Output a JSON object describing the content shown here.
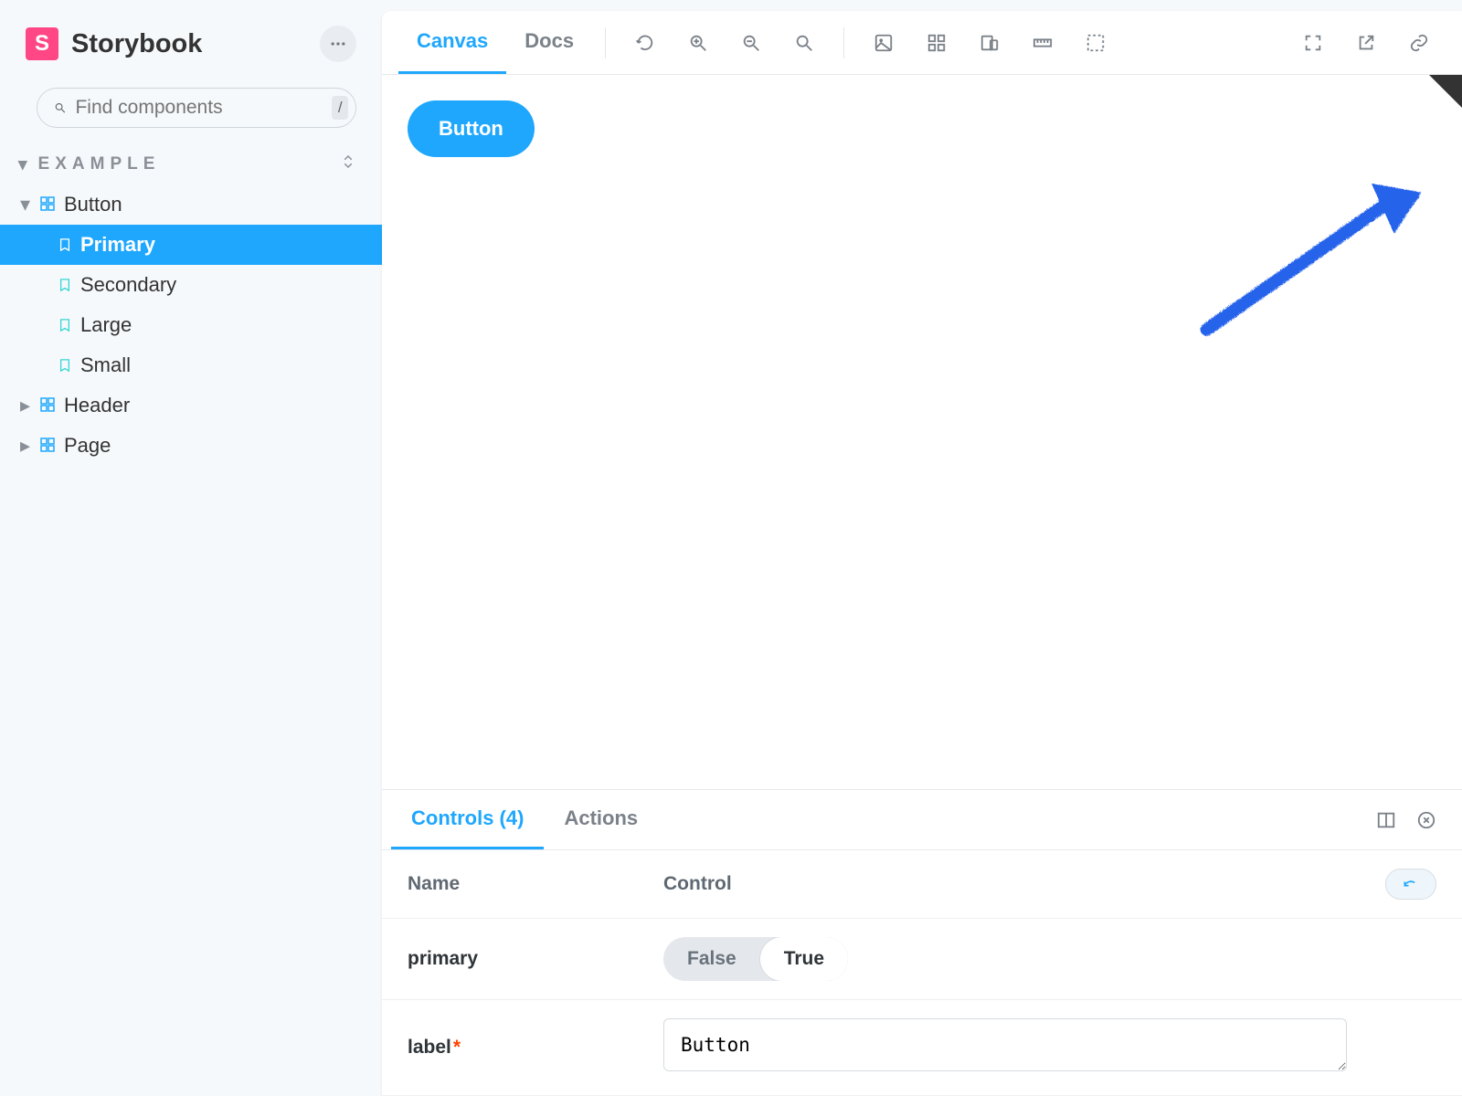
{
  "brand": {
    "name": "Storybook",
    "logo_letter": "S"
  },
  "search": {
    "placeholder": "Find components",
    "shortcut": "/"
  },
  "sidebar": {
    "group_label": "EXAMPLE",
    "items": [
      {
        "type": "component",
        "label": "Button",
        "expanded": true,
        "children": [
          {
            "label": "Primary",
            "active": true
          },
          {
            "label": "Secondary",
            "active": false
          },
          {
            "label": "Large",
            "active": false
          },
          {
            "label": "Small",
            "active": false
          }
        ]
      },
      {
        "type": "component",
        "label": "Header",
        "expanded": false,
        "children": []
      },
      {
        "type": "component",
        "label": "Page",
        "expanded": false,
        "children": []
      }
    ]
  },
  "toolbar": {
    "tabs": [
      {
        "label": "Canvas",
        "active": true
      },
      {
        "label": "Docs",
        "active": false
      }
    ]
  },
  "preview": {
    "button_label": "Button"
  },
  "addons": {
    "tabs": [
      {
        "label": "Controls (4)",
        "active": true
      },
      {
        "label": "Actions",
        "active": false
      }
    ],
    "header": {
      "name": "Name",
      "control": "Control"
    },
    "rows": [
      {
        "name": "primary",
        "required": false,
        "type": "boolean",
        "options": {
          "off": "False",
          "on": "True"
        },
        "value": true
      },
      {
        "name": "label",
        "required": true,
        "type": "text",
        "value": "Button"
      }
    ]
  }
}
